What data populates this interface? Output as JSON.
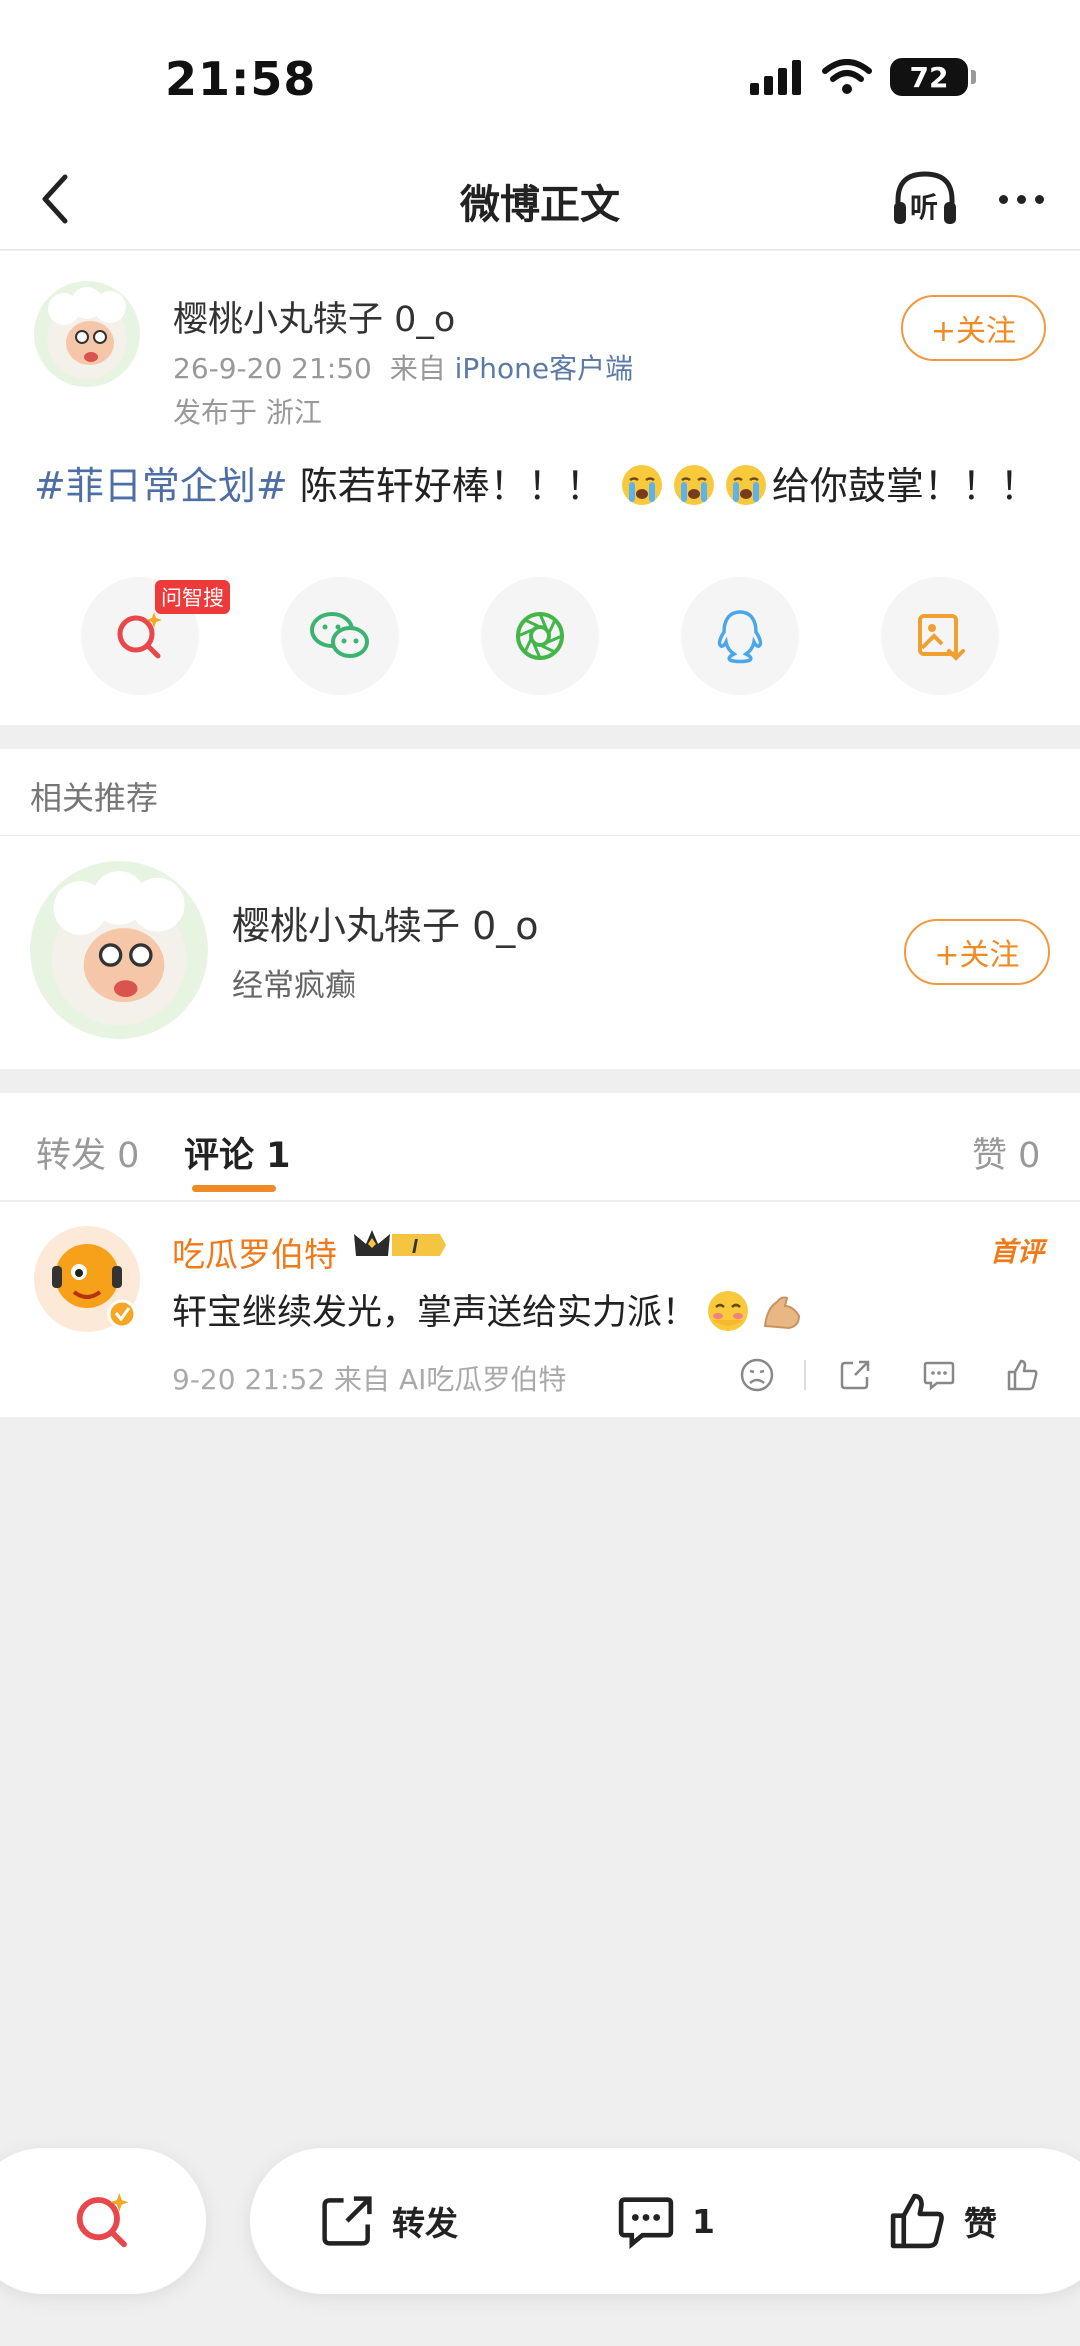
{
  "status_bar": {
    "time": "21:58",
    "battery": "72"
  },
  "nav": {
    "title": "微博正文",
    "listen_label": "听"
  },
  "post": {
    "author": "樱桃小丸犊子 0_o",
    "time": "26-9-20 21:50",
    "source_prefix": "来自",
    "source": "iPhone客户端",
    "location": "发布于 浙江",
    "follow_label": "+关注",
    "hashtag": "#菲日常企划#",
    "text_main": " 陈若轩好棒！！！",
    "text_tail": "给你鼓掌！！！",
    "emoji_name": "crying-emoji",
    "ai_badge": "问智搜",
    "share_buttons": [
      "ai-search-icon",
      "wechat-icon",
      "moments-icon",
      "qq-icon",
      "save-image-icon"
    ]
  },
  "recommend": {
    "title": "相关推荐",
    "name": "樱桃小丸犊子 0_o",
    "desc": "经常疯癫",
    "follow_label": "+关注"
  },
  "tabs": {
    "repost": "转发 0",
    "comment": "评论 1",
    "like": "赞 0"
  },
  "comment": {
    "name": "吃瓜罗伯特",
    "badge_level": "I",
    "first_label": "首评",
    "text": "轩宝继续发光，掌声送给实力派！",
    "meta": "9-20 21:52  来自 AI吃瓜罗伯特"
  },
  "bottom_bar": {
    "repost_label": "转发",
    "comment_count": "1",
    "like_label": "赞"
  },
  "colors": {
    "accent": "#f08a24",
    "link": "#4d6fa5",
    "badge": "#ee3a3a"
  }
}
